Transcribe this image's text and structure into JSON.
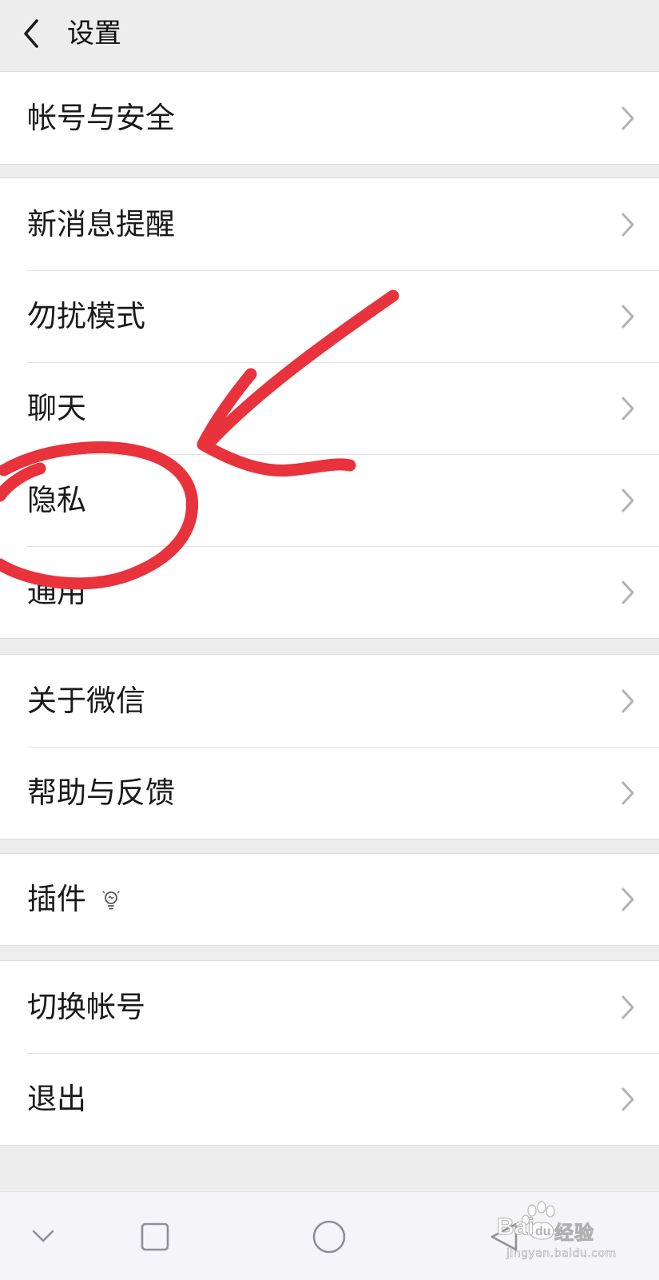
{
  "header": {
    "title": "设置",
    "back_icon": "chevron-left-icon"
  },
  "groups": [
    {
      "items": [
        {
          "label": "帐号与安全"
        }
      ]
    },
    {
      "items": [
        {
          "label": "新消息提醒"
        },
        {
          "label": "勿扰模式"
        },
        {
          "label": "聊天"
        },
        {
          "label": "隐私"
        },
        {
          "label": "通用"
        }
      ]
    },
    {
      "items": [
        {
          "label": "关于微信"
        },
        {
          "label": "帮助与反馈"
        }
      ]
    },
    {
      "items": [
        {
          "label": "插件",
          "icon": "lightbulb-icon"
        }
      ]
    },
    {
      "items": [
        {
          "label": "切换帐号"
        },
        {
          "label": "退出"
        }
      ]
    }
  ],
  "navbar": {
    "buttons": [
      "nav-hide-icon",
      "nav-recents-icon",
      "nav-home-icon",
      "nav-back-icon"
    ]
  },
  "watermark": {
    "brand": "经验",
    "url": "jingyan.baidu.com"
  },
  "annotation": {
    "color": "#e8323c"
  }
}
